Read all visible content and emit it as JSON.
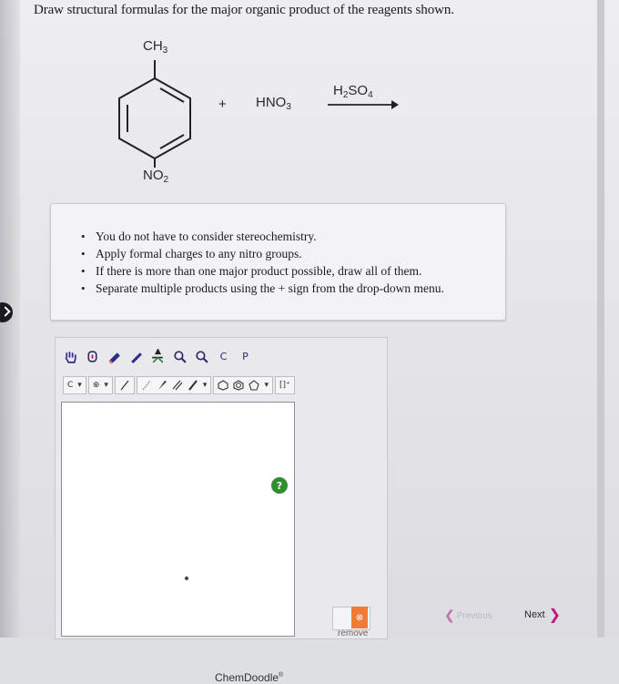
{
  "question": {
    "text": "Draw structural formulas for the major organic product of the reagents shown."
  },
  "reaction": {
    "substituent_top": "CH",
    "substituent_top_sub": "3",
    "substituent_bottom": "NO",
    "substituent_bottom_sub": "2",
    "plus": "+",
    "reagent": "HNO",
    "reagent_sub": "3",
    "catalyst_a": "H",
    "catalyst_a_sub": "2",
    "catalyst_b": "SO",
    "catalyst_b_sub": "4"
  },
  "instructions": [
    "You do not have to consider stereochemistry.",
    "Apply formal charges to any nitro groups.",
    "If there is more than one major product possible, draw all of them.",
    "Separate multiple products using the + sign from the drop-down menu."
  ],
  "editor": {
    "toolbar_labels": {
      "carbon": "C",
      "copy": "C",
      "paste": "P"
    },
    "charge_symbol": "⊕",
    "help": "?",
    "brand": "ChemDoodle",
    "brand_mark": "®"
  },
  "navigation": {
    "remove_label": "remove",
    "previous_label": "Previous",
    "next_label": "Next"
  },
  "colors": {
    "help_green": "#2f8f2f",
    "remove_orange": "#ef7a3a",
    "next_magenta": "#c2187a"
  }
}
